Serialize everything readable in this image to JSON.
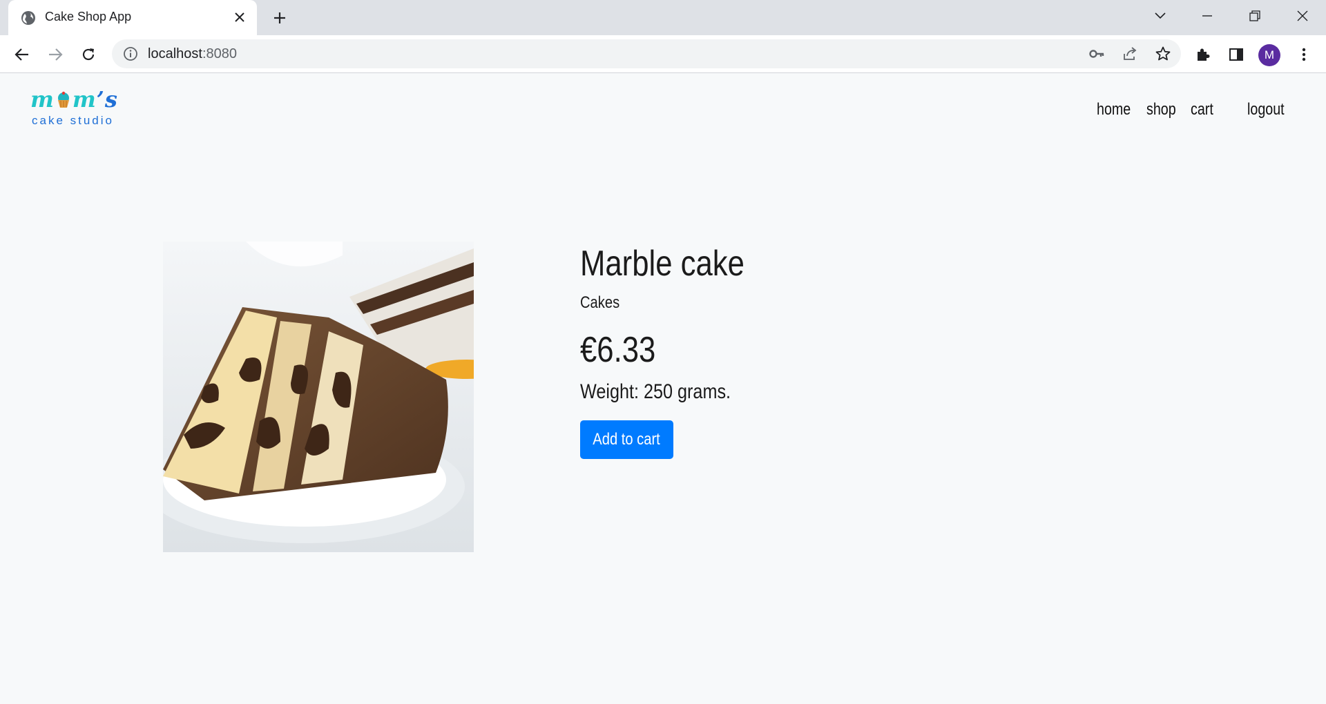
{
  "browser": {
    "tab_title": "Cake Shop App",
    "url_host": "localhost",
    "url_port": ":8080",
    "profile_initial": "M",
    "profile_color": "#5a2ca0"
  },
  "header": {
    "logo_top": "m",
    "logo_top_mid": "m",
    "logo_top_end": "’s",
    "logo_sub": "cake studio",
    "nav": {
      "home": "home",
      "shop": "shop",
      "cart": "cart",
      "logout": "logout"
    }
  },
  "product": {
    "name": "Marble cake",
    "category": "Cakes",
    "price": "€6.33",
    "weight": "Weight: 250 grams.",
    "add_to_cart": "Add to cart"
  },
  "colors": {
    "accent": "#007bff",
    "logo_teal": "#21c4c8",
    "logo_blue": "#1f6fd6"
  }
}
